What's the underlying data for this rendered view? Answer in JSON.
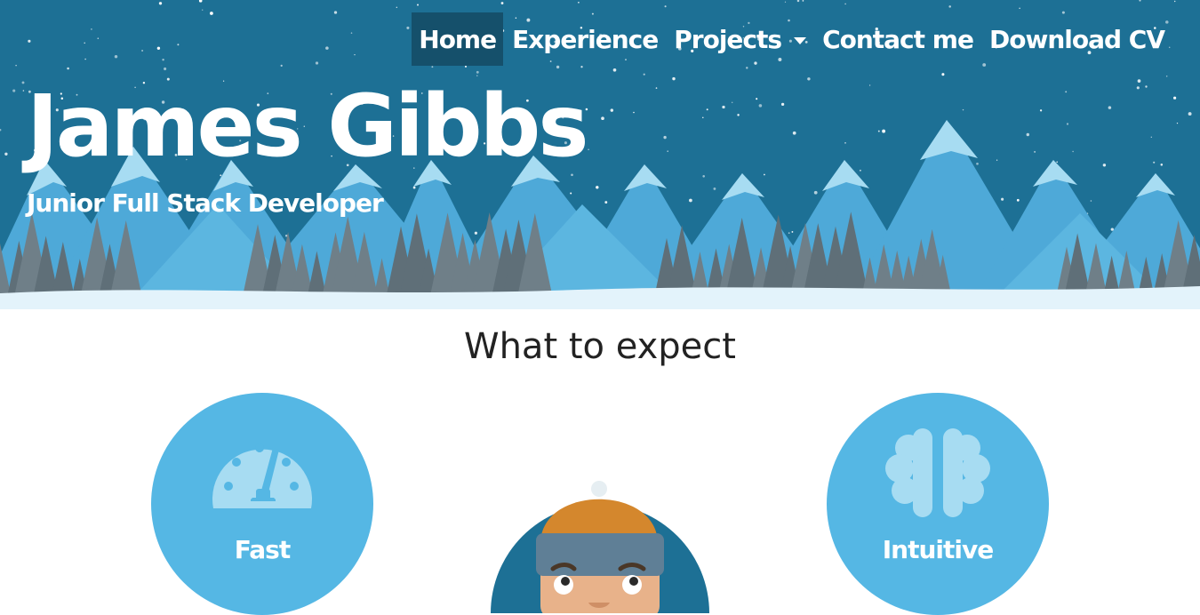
{
  "nav": {
    "items": [
      {
        "label": "Home",
        "active": true
      },
      {
        "label": "Experience",
        "active": false
      },
      {
        "label": "Projects",
        "active": false,
        "has_dropdown": true
      },
      {
        "label": "Contact me",
        "active": false
      },
      {
        "label": "Download CV",
        "active": false
      }
    ]
  },
  "hero": {
    "title": "James Gibbs",
    "subtitle": "Junior Full Stack Developer"
  },
  "features": {
    "heading": "What to expect",
    "items": [
      {
        "label": "Fast",
        "icon": "speedometer-icon"
      },
      {
        "label": "Intuitive",
        "icon": "brain-icon"
      }
    ]
  },
  "colors": {
    "sky": "#1d7095",
    "mountain_light": "#a7dcf2",
    "mountain_mid": "#4ea9d8",
    "snow": "#e3f3fb",
    "circle": "#55b7e4",
    "nav_active": "#15506b"
  }
}
